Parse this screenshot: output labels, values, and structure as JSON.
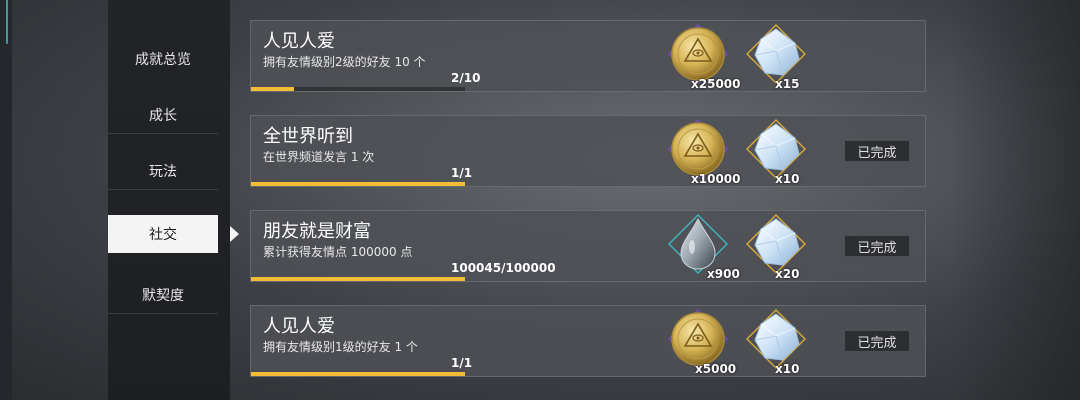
{
  "sidebar": {
    "items": [
      {
        "label": "成就总览",
        "active": false
      },
      {
        "label": "成长",
        "active": false
      },
      {
        "label": "玩法",
        "active": false
      },
      {
        "label": "社交",
        "active": true
      },
      {
        "label": "默契度",
        "active": false
      }
    ]
  },
  "achievements": [
    {
      "title": "人见人爱",
      "description": "拥有友情级别2级的好友 10 个",
      "progress_text": "2/10",
      "progress": 0.2,
      "rewards": [
        {
          "icon": "gold-coin-icon",
          "count": "x25000"
        },
        {
          "icon": "crystal-icon",
          "count": "x15"
        }
      ],
      "status": ""
    },
    {
      "title": "全世界听到",
      "description": "在世界频道发言 1 次",
      "progress_text": "1/1",
      "progress": 1.0,
      "rewards": [
        {
          "icon": "gold-coin-icon",
          "count": "x10000"
        },
        {
          "icon": "crystal-icon",
          "count": "x10"
        }
      ],
      "status": "已完成"
    },
    {
      "title": "朋友就是财富",
      "description": "累计获得友情点 100000 点",
      "progress_text": "100045/100000",
      "progress": 1.0,
      "rewards": [
        {
          "icon": "water-drop-icon",
          "count": "x900"
        },
        {
          "icon": "crystal-icon",
          "count": "x20"
        }
      ],
      "status": "已完成"
    },
    {
      "title": "人见人爱",
      "description": "拥有友情级别1级的好友 1 个",
      "progress_text": "1/1",
      "progress": 1.0,
      "rewards": [
        {
          "icon": "gold-coin-icon",
          "count": "x5000"
        },
        {
          "icon": "crystal-icon",
          "count": "x10"
        }
      ],
      "status": "已完成"
    }
  ],
  "colors": {
    "progress": "#f2bc37",
    "accent": "#3f9a96",
    "coin": "#d8b85a",
    "crystal": "#cfe4f6"
  }
}
